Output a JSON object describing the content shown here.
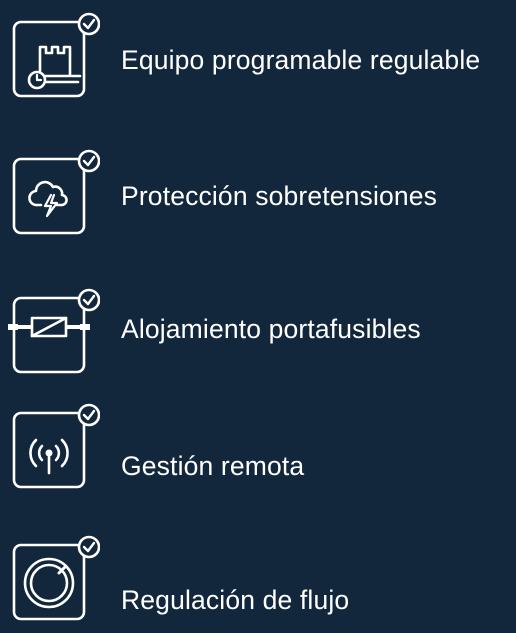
{
  "features": [
    {
      "label": "Equipo programable regulable",
      "icon": "programmable-factory-clock-icon"
    },
    {
      "label": "Protección sobretensiones",
      "icon": "cloud-lightning-icon"
    },
    {
      "label": "Alojamiento portafusibles",
      "icon": "fuse-holder-icon"
    },
    {
      "label": "Gestión remota",
      "icon": "remote-signal-icon"
    },
    {
      "label": "Regulación de flujo",
      "icon": "flow-knob-icon"
    }
  ],
  "colors": {
    "background": "#13273c",
    "foreground": "#ffffff"
  }
}
